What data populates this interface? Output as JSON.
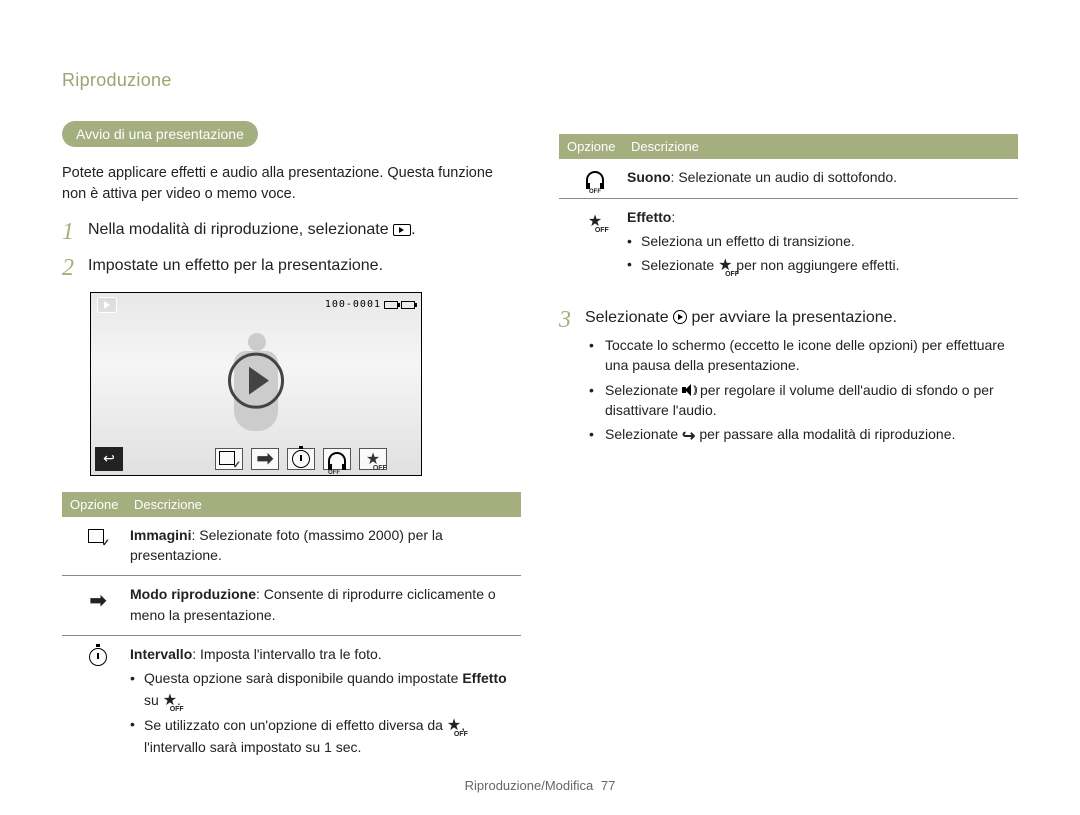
{
  "header": {
    "section": "Riproduzione"
  },
  "left": {
    "pill": "Avvio di una presentazione",
    "intro": "Potete applicare effetti e audio alla presentazione. Questa funzione non è attiva per video o memo voce.",
    "step1": "Nella modalità di riproduzione, selezionate ",
    "step1_suffix": ".",
    "step2": "Impostate un effetto per la presentazione.",
    "screenshot": {
      "counter": "100-0001"
    },
    "table": {
      "col1": "Opzione",
      "col2": "Descrizione",
      "rows": {
        "images": {
          "title": "Immagini",
          "body": ": Selezionate foto (massimo 2000) per la presentazione."
        },
        "playmode": {
          "title": "Modo riproduzione",
          "body": ": Consente di riprodurre ciclicamente o meno la presentazione."
        },
        "interval": {
          "title": "Intervallo",
          "body": ": Imposta l'intervallo tra le foto.",
          "b1a": "Questa opzione sarà disponibile quando impostate ",
          "b1b": "Effetto",
          "b1c": " su ",
          "b1d": ".",
          "b2a": "Se utilizzato con un'opzione di effetto diversa da ",
          "b2b": ", l'intervallo sarà impostato su 1 sec."
        }
      }
    }
  },
  "right": {
    "table": {
      "col1": "Opzione",
      "col2": "Descrizione",
      "rows": {
        "sound": {
          "title": "Suono",
          "body": ": Selezionate un audio di sottofondo."
        },
        "effect": {
          "title": "Effetto",
          "suffix": ":",
          "b1": "Seleziona un effetto di transizione.",
          "b2a": "Selezionate ",
          "b2b": " per non aggiungere effetti."
        }
      }
    },
    "step3": {
      "num": "3",
      "text_a": "Selezionate ",
      "text_b": " per avviare la presentazione.",
      "b1": "Toccate lo schermo (eccetto le icone delle opzioni) per effettuare una pausa della presentazione.",
      "b2a": "Selezionate ",
      "b2b": " per regolare il volume dell'audio di sfondo o per disattivare l'audio.",
      "b3a": "Selezionate ",
      "b3b": " per passare alla modalità di riproduzione."
    }
  },
  "footer": {
    "text": "Riproduzione/Modifica",
    "page": "77"
  },
  "step_nums": {
    "s1": "1",
    "s2": "2",
    "s3": "3"
  }
}
